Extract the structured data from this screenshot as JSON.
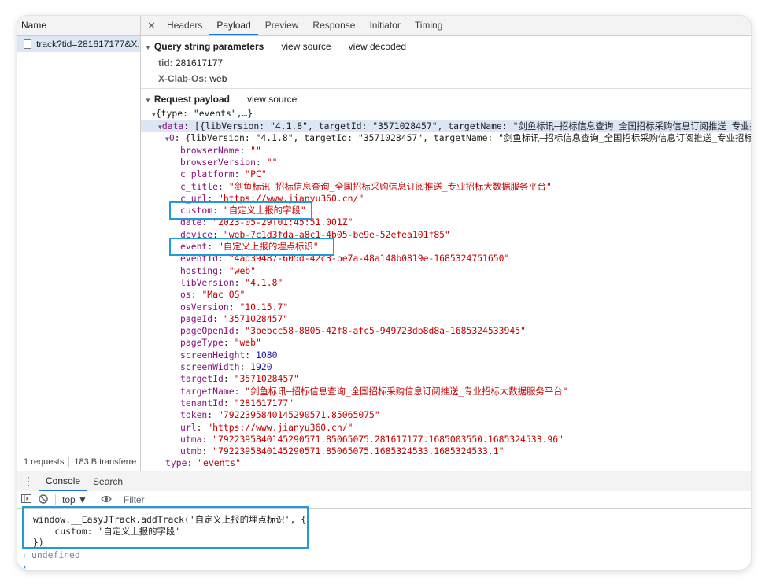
{
  "network": {
    "name_header": "Name",
    "request_name": "track?tid=281617177&X...",
    "footer_requests": "1 requests",
    "footer_transferred": "183 B transferre"
  },
  "detail_tabs": [
    "Headers",
    "Payload",
    "Preview",
    "Response",
    "Initiator",
    "Timing"
  ],
  "query": {
    "title": "Query string parameters",
    "view_source": "view source",
    "view_decoded": "view decoded",
    "params": [
      {
        "key": "tid:",
        "value": "281617177"
      },
      {
        "key": "X-Clab-Os:",
        "value": "web"
      }
    ]
  },
  "payload": {
    "title": "Request payload",
    "view_source": "view source",
    "root_summary": "{type: \"events\",…}",
    "data_key": "data",
    "data_summary": ": [{libVersion: \"4.1.8\", targetId: \"3571028457\", targetName: \"剑鱼标讯—招标信息查询_全国招标采购信息订阅推送_专业招标大数",
    "item_key": "0",
    "item_summary": ": {libVersion: \"4.1.8\", targetId: \"3571028457\", targetName: \"剑鱼标讯—招标信息查询_全国招标采购信息订阅推送_专业招标大数据",
    "fields": [
      {
        "key": "browserName",
        "value": "\"\"",
        "kind": "str"
      },
      {
        "key": "browserVersion",
        "value": "\"\"",
        "kind": "str"
      },
      {
        "key": "c_platform",
        "value": "\"PC\"",
        "kind": "str"
      },
      {
        "key": "c_title",
        "value": "\"剑鱼标讯—招标信息查询_全国招标采购信息订阅推送_专业招标大数据服务平台\"",
        "kind": "str"
      },
      {
        "key": "c_url",
        "value": "\"https://www.jianyu360.cn/\"",
        "kind": "str"
      },
      {
        "key": "custom",
        "value": "\"自定义上报的字段\"",
        "kind": "str"
      },
      {
        "key": "date",
        "value": "\"2023-05-29T01:45:51.001Z\"",
        "kind": "str"
      },
      {
        "key": "device",
        "value": "\"web-7c1d3fda-a8c1-4b05-be9e-52efea101f85\"",
        "kind": "str"
      },
      {
        "key": "event",
        "value": "\"自定义上报的埋点标识\"",
        "kind": "str"
      },
      {
        "key": "eventId",
        "value": "\"4ad39487-605d-42c3-be7a-48a148b0819e-1685324751650\"",
        "kind": "str"
      },
      {
        "key": "hosting",
        "value": "\"web\"",
        "kind": "str"
      },
      {
        "key": "libVersion",
        "value": "\"4.1.8\"",
        "kind": "str"
      },
      {
        "key": "os",
        "value": "\"Mac OS\"",
        "kind": "str"
      },
      {
        "key": "osVersion",
        "value": "\"10.15.7\"",
        "kind": "str"
      },
      {
        "key": "pageId",
        "value": "\"3571028457\"",
        "kind": "str"
      },
      {
        "key": "pageOpenId",
        "value": "\"3bebcc58-8805-42f8-afc5-949723db8d8a-1685324533945\"",
        "kind": "str"
      },
      {
        "key": "pageType",
        "value": "\"web\"",
        "kind": "str"
      },
      {
        "key": "screenHeight",
        "value": "1080",
        "kind": "num"
      },
      {
        "key": "screenWidth",
        "value": "1920",
        "kind": "num"
      },
      {
        "key": "targetId",
        "value": "\"3571028457\"",
        "kind": "str"
      },
      {
        "key": "targetName",
        "value": "\"剑鱼标讯—招标信息查询_全国招标采购信息订阅推送_专业招标大数据服务平台\"",
        "kind": "str"
      },
      {
        "key": "tenantId",
        "value": "\"281617177\"",
        "kind": "str"
      },
      {
        "key": "token",
        "value": "\"7922395840145290571.85065075\"",
        "kind": "str"
      },
      {
        "key": "url",
        "value": "\"https://www.jianyu360.cn/\"",
        "kind": "str"
      },
      {
        "key": "utma",
        "value": "\"7922395840145290571.85065075.281617177.1685003550.1685324533.96\"",
        "kind": "str"
      },
      {
        "key": "utmb",
        "value": "\"7922395840145290571.85065075.1685324533.1685324533.1\"",
        "kind": "str"
      }
    ],
    "type_key": "type",
    "type_value": "\"events\""
  },
  "drawer": {
    "tabs": [
      "Console",
      "Search"
    ],
    "context": "top ▼",
    "filter_placeholder": "Filter"
  },
  "console": {
    "line1": "window.__EasyJTrack.addTrack('自定义上报的埋点标识', {",
    "line2": "    custom: '自定义上报的字段'",
    "line3": "})",
    "result": "undefined"
  },
  "colors": {
    "highlight_box": "#1f9bd7",
    "key_purple": "#881280",
    "string_red": "#c80000",
    "number_blue": "#1a1aa6",
    "selection": "#dde6f5",
    "active_tab": "#1a73e8"
  }
}
